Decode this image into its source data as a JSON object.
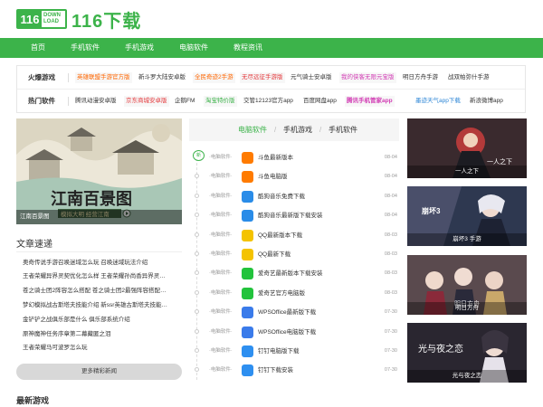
{
  "site": {
    "logo_number": "116",
    "logo_sub_line1": "DOWN",
    "logo_sub_line2": "LOAD",
    "logo_text": "116下载",
    "brand_color": "#3cb34a"
  },
  "nav": {
    "items": [
      "首页",
      "手机软件",
      "手机游戏",
      "电脑软件",
      "教程资讯"
    ]
  },
  "hot": {
    "row1_label": "火爆游戏",
    "row1_links": [
      "英雄联盟手游官方版",
      "新斗罗大陆安卓版",
      "全民奇迹2手游",
      "无尽远征手游版",
      "元气骑士安卓版",
      "我的侠客无限元宝版",
      "明日方舟手游",
      "战双帕弥什手游"
    ],
    "row2_label": "热门软件",
    "row2_links": [
      "腾讯动漫安卓版",
      "京东商城安卓版",
      "企鹅FM",
      "淘宝特价版",
      "交管12123官方app",
      "百度网盘app",
      "腾讯手机管家app",
      "墨迹天气app下载",
      "新浪微博app"
    ]
  },
  "banner": {
    "caption": "江南百景图",
    "painted_title": "江南百景图",
    "painted_sub": "模拟大明 经营江南"
  },
  "articles": {
    "title": "文章速递",
    "items": [
      "奥奇传说手游召唤迷域怎么玩 召唤迷域玩法介绍",
      "王者荣耀异界灵契优化怎么样 王者荣耀孙尚香异界灵…",
      "苍之骑士团2阵容怎么搭配 苍之骑士团2最强阵容搭配…",
      "梦幻模拟战古斯塔夫技能介绍 新ssr英雄古斯塔夫技能…",
      "金铲铲之战俱乐部是什么 俱乐部系统介绍",
      "原神魔神任务序章第二幕藏匿之泪",
      "王者荣耀马可波罗怎么玩"
    ],
    "more": "更多精彩新闻"
  },
  "newest_title": "最新游戏",
  "mid": {
    "tabs": [
      "电脑软件",
      "手机游戏",
      "手机软件"
    ],
    "separator": "/",
    "new_badge": "新",
    "rows": [
      {
        "cat": "·电脑软件·",
        "title": "斗鱼最新版本",
        "date": "08-04",
        "icon": "douyu-icon",
        "color": "#ff7b00"
      },
      {
        "cat": "·电脑软件·",
        "title": "斗鱼电脑版",
        "date": "08-04",
        "icon": "douyu-icon",
        "color": "#ff7b00"
      },
      {
        "cat": "·电脑软件·",
        "title": "酷狗音乐免费下载",
        "date": "08-04",
        "icon": "kugou-icon",
        "color": "#2a8ce8"
      },
      {
        "cat": "·电脑软件·",
        "title": "酷狗音乐最新版下载安装",
        "date": "08-04",
        "icon": "kugou-icon",
        "color": "#2a8ce8"
      },
      {
        "cat": "·电脑软件·",
        "title": "QQ最新版本下载",
        "date": "08-03",
        "icon": "qq-icon",
        "color": "#f4c300"
      },
      {
        "cat": "·电脑软件·",
        "title": "QQ最新下载",
        "date": "08-03",
        "icon": "qq-icon",
        "color": "#f4c300"
      },
      {
        "cat": "·电脑软件·",
        "title": "爱奇艺最新版本下载安装",
        "date": "08-03",
        "icon": "iqiyi-icon",
        "color": "#22c33c"
      },
      {
        "cat": "·电脑软件·",
        "title": "爱奇艺官方电脑版",
        "date": "08-03",
        "icon": "iqiyi-icon",
        "color": "#22c33c"
      },
      {
        "cat": "·电脑软件·",
        "title": "WPSOffice最新版下载",
        "date": "07-30",
        "icon": "wps-icon",
        "color": "#3a7bea"
      },
      {
        "cat": "·电脑软件·",
        "title": "WPSOffice电脑版下载",
        "date": "07-30",
        "icon": "wps-icon",
        "color": "#3a7bea"
      },
      {
        "cat": "·电脑软件·",
        "title": "钉钉电脑版下载",
        "date": "07-30",
        "icon": "dingtalk-icon",
        "color": "#2e8ff0"
      },
      {
        "cat": "·电脑软件·",
        "title": "钉钉下载安装",
        "date": "07-30",
        "icon": "dingtalk-icon",
        "color": "#2e8ff0"
      }
    ]
  },
  "right": {
    "cards": [
      {
        "label": "一人之下",
        "overlay": "一人之下"
      },
      {
        "label": "崩坏3 手游",
        "overlay": "崩坏3"
      },
      {
        "label": "明日方舟",
        "overlay": "明日方舟"
      },
      {
        "label": "光与夜之恋",
        "overlay": "光与夜之恋"
      }
    ]
  }
}
